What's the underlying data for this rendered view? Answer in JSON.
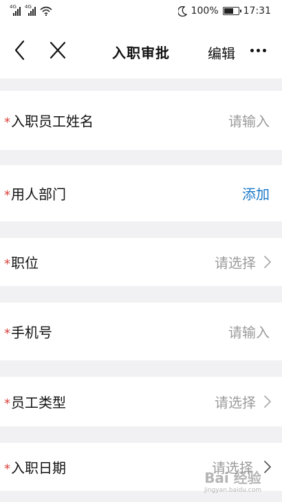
{
  "status_bar": {
    "signal_label_1": "4G",
    "signal_label_2": "4G",
    "battery_percent": "100%",
    "time": "17:31"
  },
  "nav": {
    "title": "入职审批",
    "edit_label": "编辑"
  },
  "form": {
    "required_mark": "*",
    "rows": [
      {
        "label": "入职员工姓名",
        "value": "请输入"
      },
      {
        "label": "用人部门",
        "value": "添加"
      },
      {
        "label": "职位",
        "value": "请选择"
      },
      {
        "label": "手机号",
        "value": "请输入"
      },
      {
        "label": "员工类型",
        "value": "请选择"
      },
      {
        "label": "入职日期",
        "value": "请选择"
      }
    ]
  },
  "watermark": {
    "brand": "Bai 经验",
    "url": "jingyan.baidu.com"
  },
  "colors": {
    "required": "#d9413a",
    "link": "#1a78c8",
    "placeholder": "#9b9b9b",
    "background": "#f1f1f3"
  },
  "icons": [
    "back-arrow-icon",
    "close-icon",
    "more-icon",
    "chevron-right-icon",
    "moon-icon",
    "wifi-icon",
    "battery-icon"
  ]
}
